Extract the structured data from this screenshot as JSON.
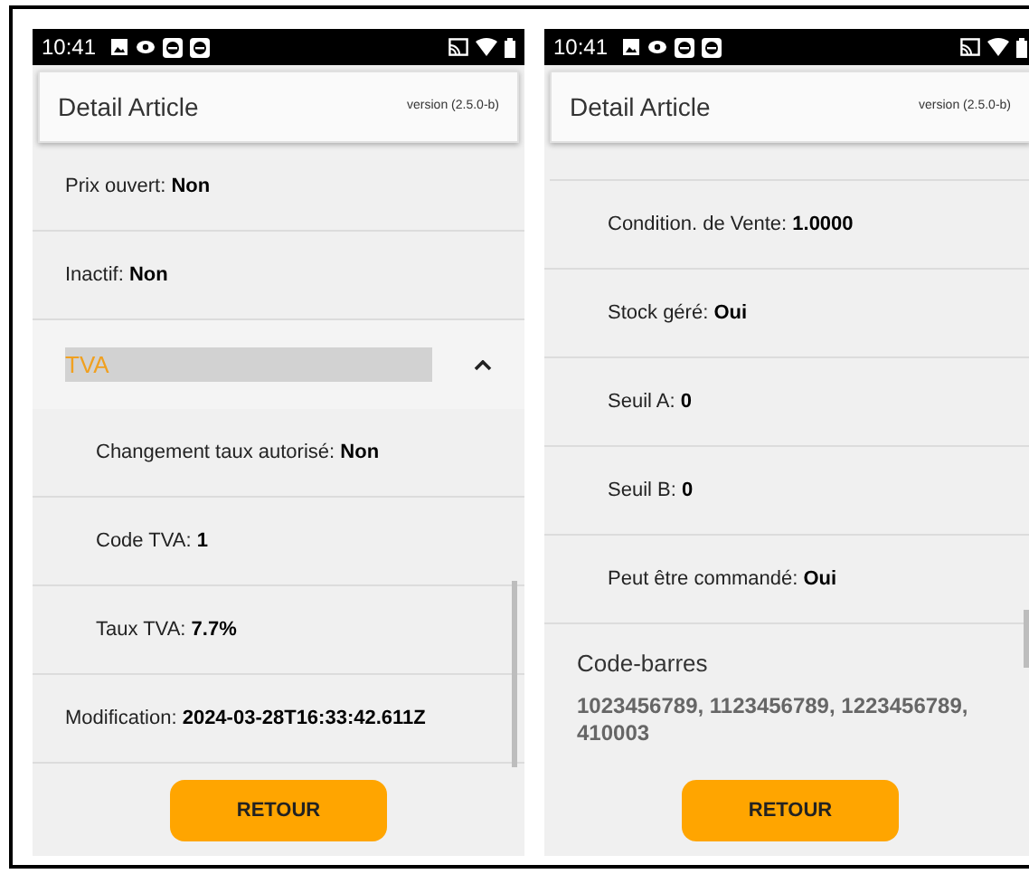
{
  "screens": [
    {
      "status_bar": {
        "time": "10:41"
      },
      "header": {
        "title": "Detail Article",
        "version": "version (2.5.0-b)"
      },
      "scrolled": false,
      "rows": [
        {
          "kind": "field",
          "label": "Prix ouvert:",
          "value": "Non"
        },
        {
          "kind": "field",
          "label": "Inactif:",
          "value": "Non"
        },
        {
          "kind": "accordion",
          "label": "TVA",
          "expanded": true,
          "selected": true
        },
        {
          "kind": "subfield",
          "label": "Changement taux autorisé:",
          "value": "Non"
        },
        {
          "kind": "subfield",
          "label": "Code TVA:",
          "value": "1"
        },
        {
          "kind": "subfield",
          "label": "Taux TVA:",
          "value": "7.7%"
        },
        {
          "kind": "field",
          "label": "Modification:",
          "value": "2024-03-28T16:33:42.611Z"
        }
      ],
      "button": "RETOUR"
    },
    {
      "status_bar": {
        "time": "10:41"
      },
      "header": {
        "title": "Detail Article",
        "version": "version (2.5.0-b)"
      },
      "scrolled": true,
      "rows": [
        {
          "kind": "subfield",
          "label": "Condition. de Vente:",
          "value": "1.0000"
        },
        {
          "kind": "subfield",
          "label": "Stock géré:",
          "value": "Oui"
        },
        {
          "kind": "subfield",
          "label": "Seuil A:",
          "value": "0"
        },
        {
          "kind": "subfield",
          "label": "Seuil B:",
          "value": "0"
        },
        {
          "kind": "subfield",
          "label": "Peut être commandé:",
          "value": "Oui"
        },
        {
          "kind": "section",
          "label": "Code-barres",
          "value": "1023456789, 1123456789, 1223456789, 410003"
        }
      ],
      "button": "RETOUR"
    }
  ]
}
